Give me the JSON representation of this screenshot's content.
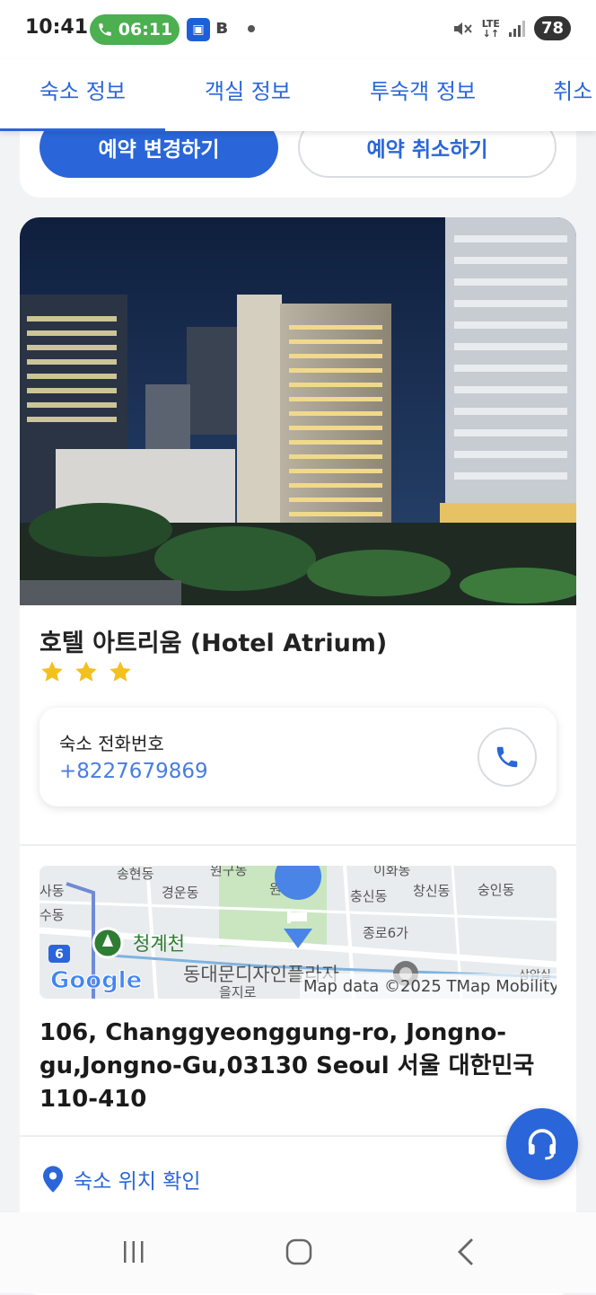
{
  "status_bar": {
    "time": "10:41",
    "call_timer": "06:11",
    "network": "LTE",
    "battery": "78"
  },
  "tabs": [
    {
      "label": "숙소 정보"
    },
    {
      "label": "객실 정보"
    },
    {
      "label": "투숙객 정보"
    },
    {
      "label": "취소"
    }
  ],
  "actions": {
    "change_label": "예약 변경하기",
    "cancel_label": "예약 취소하기"
  },
  "hotel": {
    "name": "호텔 아트리움 (Hotel Atrium)",
    "stars": 3,
    "phone_label": "숙소 전화번호",
    "phone_number": "+8227679869",
    "address": "106, Changgyeonggung-ro, Jongno-gu,Jongno-Gu,03130 Seoul 서울 대한민국 110-410",
    "location_link": "숙소 위치 확인"
  },
  "map": {
    "labels": {
      "songhyeon": "송현동",
      "gyeongun": "경운동",
      "wonnam": "원남동",
      "chungsin": "충신동",
      "changsin": "창신동",
      "sungin": "숭인동",
      "jongno6": "종로6가",
      "cheonggyecheon": "청계천",
      "ddp": "동대문디자인플라자",
      "route_badge": "6",
      "left_top": "사동",
      "left_mid": "수동",
      "right_bottom": "상암실",
      "top_right": "이화동",
      "top_mid": "원구동",
      "bottom_mid": "을지로"
    },
    "google": "Google",
    "attribution": "Map data ©2025 TMap Mobility"
  },
  "colors": {
    "accent": "#2a66d9",
    "phone_text": "#4a7ce0",
    "star": "#f4c020",
    "call_pill": "#4caf50"
  }
}
